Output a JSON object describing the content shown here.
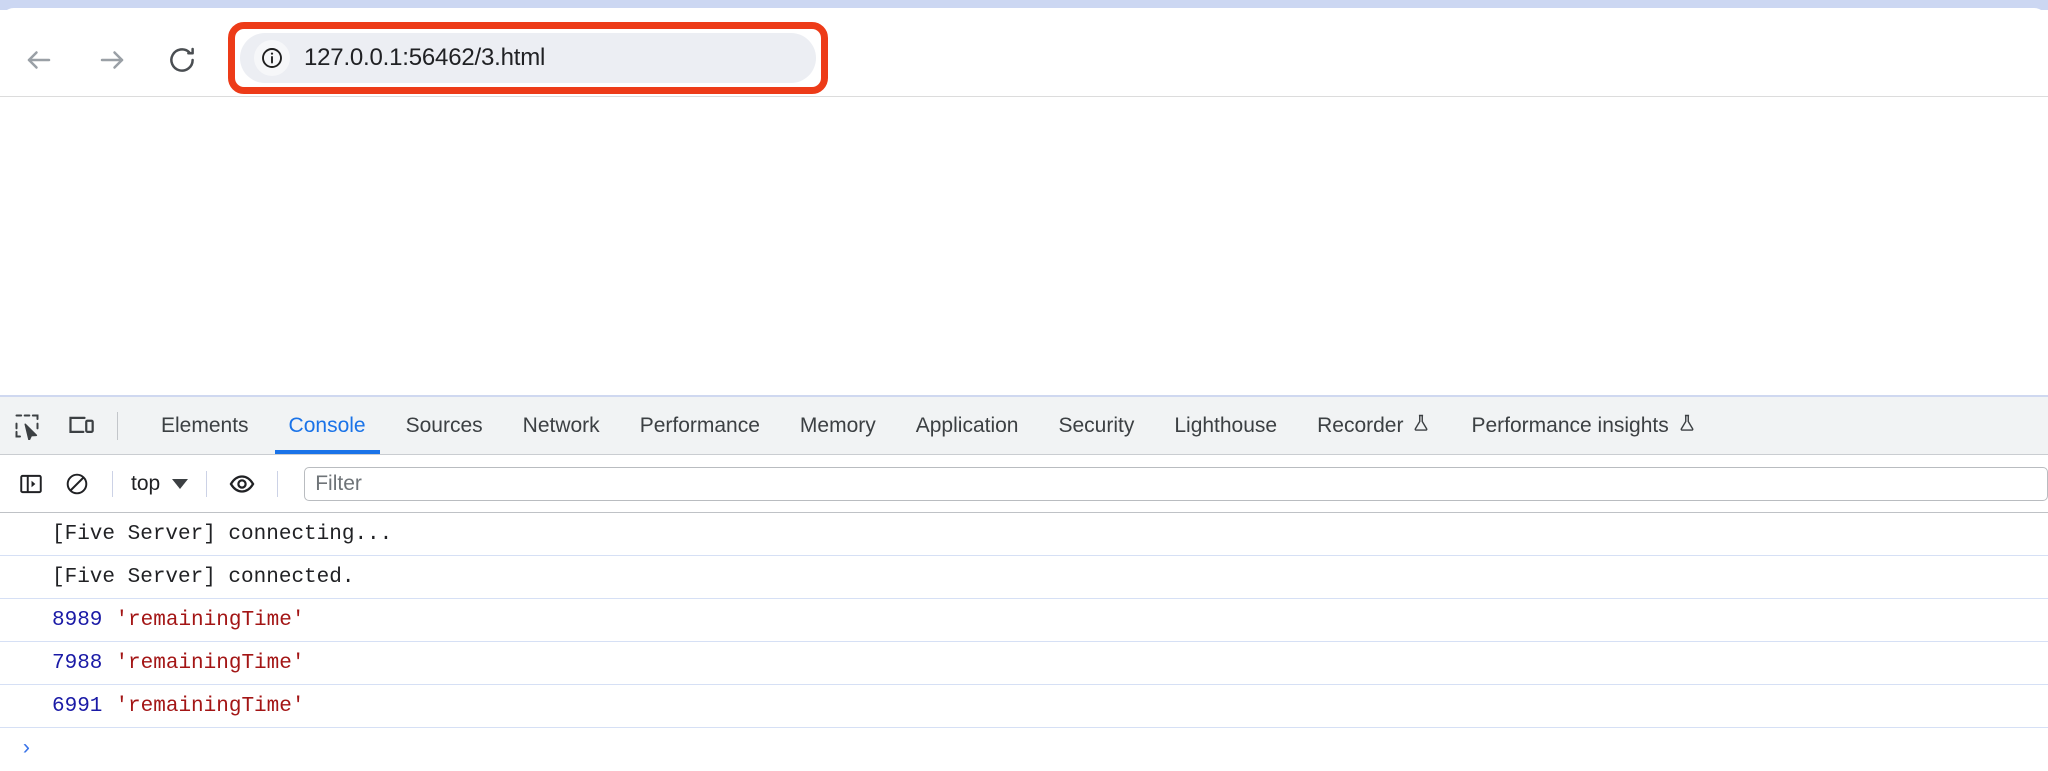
{
  "browser": {
    "nav": {
      "back_label": "Back",
      "forward_label": "Forward",
      "reload_label": "Reload"
    },
    "omnibox": {
      "url": "127.0.0.1:56462/3.html",
      "placeholder": "Search Google or type a URL",
      "site_info_icon": "info-circle-icon",
      "highlight_color": "#ed3b18"
    }
  },
  "devtools": {
    "accent_color": "#1a73e8",
    "toolbar_icons": [
      {
        "name": "inspect-element-icon",
        "label": "Inspect element"
      },
      {
        "name": "device-toolbar-icon",
        "label": "Toggle device toolbar"
      }
    ],
    "tabs": [
      {
        "label": "Elements",
        "active": false,
        "flask": false
      },
      {
        "label": "Console",
        "active": true,
        "flask": false
      },
      {
        "label": "Sources",
        "active": false,
        "flask": false
      },
      {
        "label": "Network",
        "active": false,
        "flask": false
      },
      {
        "label": "Performance",
        "active": false,
        "flask": false
      },
      {
        "label": "Memory",
        "active": false,
        "flask": false
      },
      {
        "label": "Application",
        "active": false,
        "flask": false
      },
      {
        "label": "Security",
        "active": false,
        "flask": false
      },
      {
        "label": "Lighthouse",
        "active": false,
        "flask": false
      },
      {
        "label": "Recorder",
        "active": false,
        "flask": true
      },
      {
        "label": "Performance insights",
        "active": false,
        "flask": true
      }
    ],
    "console_toolbar": {
      "sidebar_toggle_icon": "show-console-sidebar-icon",
      "clear_icon": "clear-console-icon",
      "context_value": "top",
      "context_options": [
        "top"
      ],
      "eye_icon": "live-expressions-eye-icon",
      "filter_placeholder": "Filter",
      "filter_value": ""
    },
    "console_messages": [
      {
        "type": "plain",
        "text": "[Five Server] connecting..."
      },
      {
        "type": "plain",
        "text": "[Five Server] connected."
      },
      {
        "type": "value",
        "number": "8989",
        "string": "'remainingTime'"
      },
      {
        "type": "value",
        "number": "7988",
        "string": "'remainingTime'"
      },
      {
        "type": "value",
        "number": "6991",
        "string": "'remainingTime'"
      }
    ],
    "prompt": {
      "glyph": "›"
    }
  }
}
